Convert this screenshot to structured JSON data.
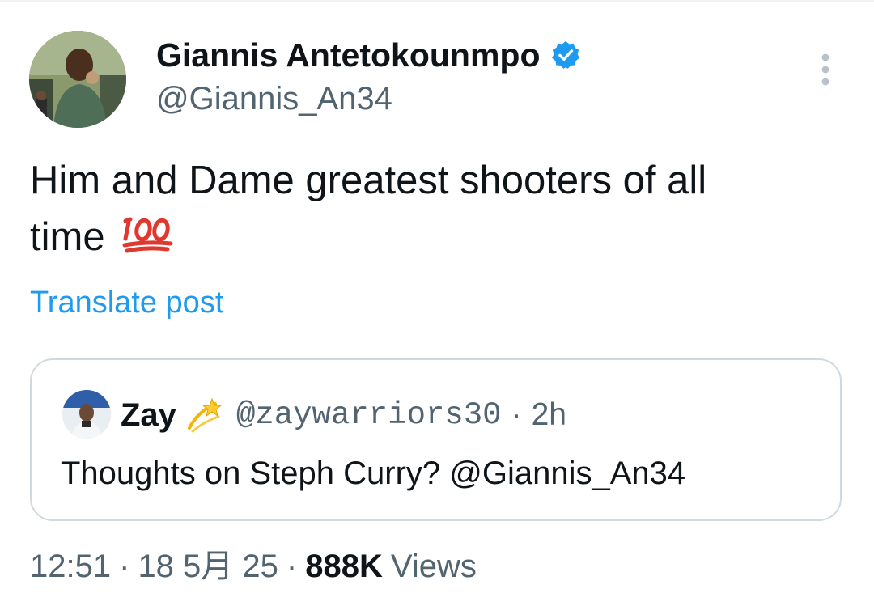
{
  "post": {
    "author": {
      "display_name": "Giannis Antetokounmpo",
      "handle": "@Giannis_An34",
      "verified": true,
      "avatar_icon": "avatar-photo"
    },
    "text_line1": "Him and Dame greatest shooters of all",
    "text_line2": "time",
    "emoji": "hundred-points-icon",
    "translate_label": "Translate post",
    "more_icon": "more-vertical-icon"
  },
  "quote": {
    "display_name": "Zay",
    "emoji": "dizzy-icon",
    "handle": "@zaywarriors30",
    "separator": "·",
    "time": "2h",
    "text": "Thoughts on Steph Curry? @Giannis_An34"
  },
  "meta": {
    "time": "12:51",
    "separator": "·",
    "date": "18 5月 25",
    "views_count": "888K",
    "views_label": "Views"
  },
  "colors": {
    "accent": "#1d9bf0",
    "secondary_text": "#536471",
    "primary_text": "#0f1419",
    "border": "#cfd9de",
    "emoji_red": "#e0382f"
  }
}
